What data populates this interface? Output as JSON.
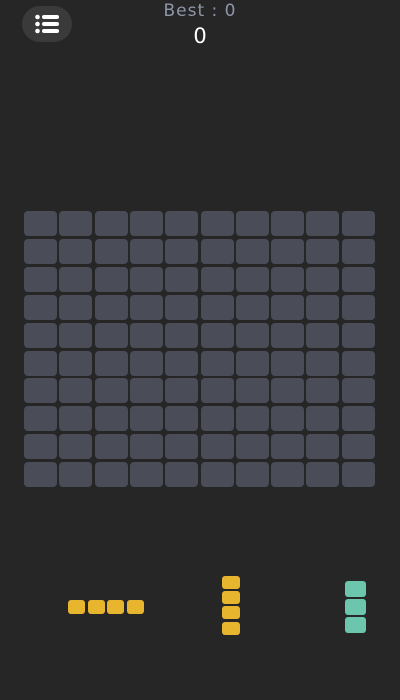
{
  "header": {
    "menu_icon": "list-menu-icon",
    "best_label": "Best : 0",
    "score": "0"
  },
  "board": {
    "rows": 10,
    "cols": 10,
    "empty_cell_color": "#4a4c57",
    "filled_cells": 0
  },
  "tray": {
    "pieces": [
      {
        "name": "horizontal-i4",
        "blocks": 4,
        "orientation": "horizontal",
        "color": "#e8b52f"
      },
      {
        "name": "vertical-i4",
        "blocks": 4,
        "orientation": "vertical",
        "color": "#e8b52f"
      },
      {
        "name": "vertical-i3",
        "blocks": 3,
        "orientation": "vertical",
        "color": "#6cc5ad"
      }
    ]
  },
  "theme": {
    "background": "#262626",
    "best_text_color": "#8f96a8",
    "score_text_color": "#ffffff"
  }
}
